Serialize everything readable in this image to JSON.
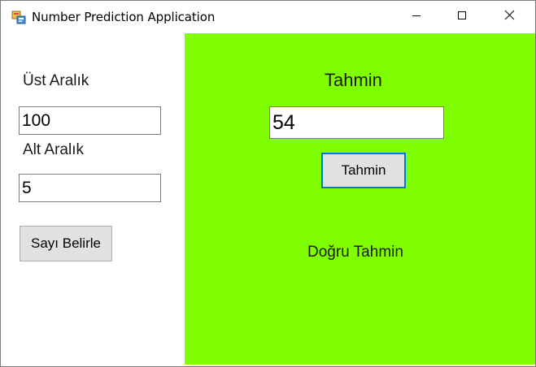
{
  "window": {
    "title": "Number Prediction Application",
    "icon": "winforms-app-icon",
    "controls": [
      "minimize-icon",
      "maximize-icon",
      "close-icon"
    ]
  },
  "left_panel": {
    "upper_label": "Üst Aralık",
    "upper_value": "100",
    "lower_label": "Alt Aralık",
    "lower_value": "5",
    "set_button_label": "Sayı Belirle"
  },
  "right_panel": {
    "background_color": "#80ff00",
    "title": "Tahmin",
    "guess_value": "54",
    "guess_button_label": "Tahmin",
    "result_text": "Doğru Tahmin"
  },
  "colors": {
    "accent_focus": "#0078d7",
    "button_face": "#e1e1e1"
  }
}
